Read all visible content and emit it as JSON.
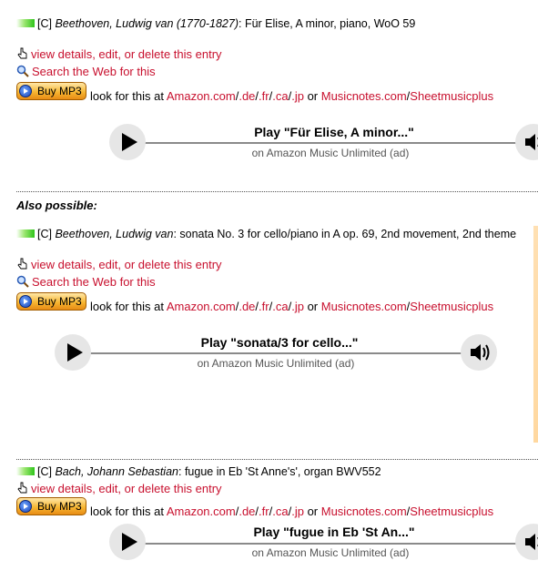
{
  "entries": [
    {
      "tag": "[C]",
      "composer": "Beethoven, Ludwig van (1770-1827)",
      "work": ": Für Elise, A minor, piano, WoO 59",
      "details_link": "view details, edit, or delete this entry",
      "search_link": "Search the Web for this",
      "buy_label": "Buy MP3",
      "look_text": "look for this at",
      "amazon": "Amazon.com",
      "de": ".de",
      "fr": ".fr",
      "ca": ".ca",
      "jp": ".jp",
      "or": "or",
      "musicnotes": "Musicnotes.com",
      "sheetmusicplus": "Sheetmusicplus",
      "slash": "/",
      "play_title": "Play \"Für Elise, A minor...\"",
      "play_sub": "on Amazon Music Unlimited (ad)"
    },
    {
      "tag": "[C]",
      "composer": "Beethoven, Ludwig van",
      "work": ": sonata No. 3 for cello/piano in A op. 69, 2nd movement, 2nd theme",
      "details_link": "view details, edit, or delete this entry",
      "search_link": "Search the Web for this",
      "buy_label": "Buy MP3",
      "look_text": "look for this at",
      "amazon": "Amazon.com",
      "de": ".de",
      "fr": ".fr",
      "ca": ".ca",
      "jp": ".jp",
      "or": "or",
      "musicnotes": "Musicnotes.com",
      "sheetmusicplus": "Sheetmusicplus",
      "slash": "/",
      "play_title": "Play \"sonata/3 for cello...\"",
      "play_sub": "on Amazon Music Unlimited (ad)"
    },
    {
      "tag": "[C]",
      "composer": "Bach, Johann Sebastian",
      "work": ": fugue in Eb 'St Anne's', organ BWV552",
      "details_link": "view details, edit, or delete this entry",
      "buy_label": "Buy MP3",
      "look_text": "look for this at",
      "amazon": "Amazon.com",
      "de": ".de",
      "fr": ".fr",
      "ca": ".ca",
      "jp": ".jp",
      "or": "or",
      "musicnotes": "Musicnotes.com",
      "sheetmusicplus": "Sheetmusicplus",
      "slash": "/",
      "play_title": "Play \"fugue in Eb 'St An...\"",
      "play_sub": "on Amazon Music Unlimited (ad)"
    }
  ],
  "also_possible": "Also possible:",
  "colors": {
    "link": "#c8102e",
    "bar": "#2ec41a",
    "button": "#f7b733"
  },
  "icons": [
    "relevance-bar-icon",
    "hand-pointer-icon",
    "magnifier-icon",
    "play-icon",
    "speaker-icon",
    "buy-mp3-disc-icon"
  ]
}
